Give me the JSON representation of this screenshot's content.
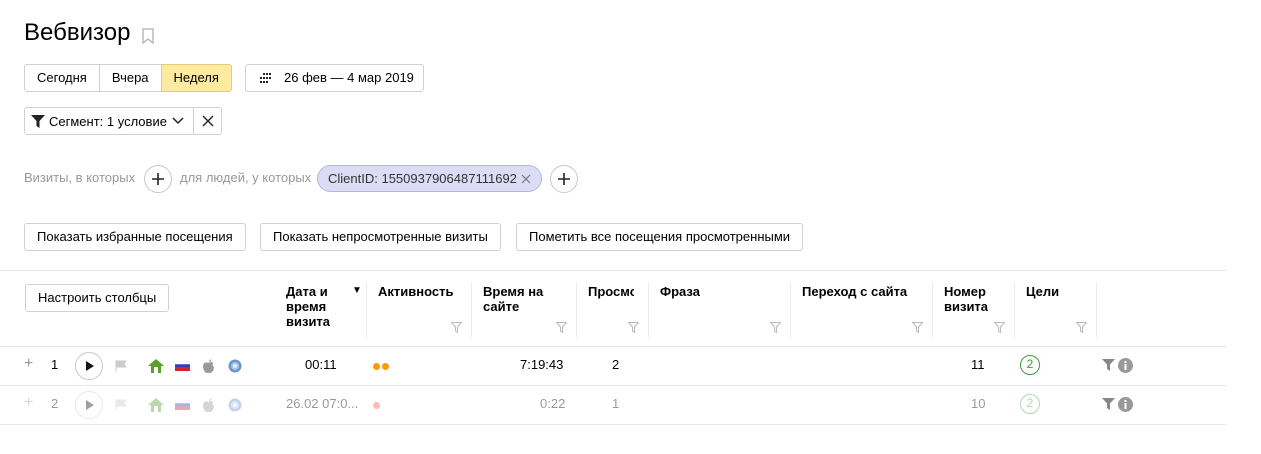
{
  "page": {
    "title": "Вебвизор"
  },
  "period": {
    "buttons": [
      "Сегодня",
      "Вчера",
      "Неделя"
    ],
    "active": "Неделя",
    "date_range": "26 фев — 4 мар 2019"
  },
  "segment": {
    "label": "Сегмент: 1 условие"
  },
  "conditions": {
    "visits_label": "Визиты, в которых",
    "people_label": "для людей, у которых",
    "chip": "ClientID: 1550937906487111692"
  },
  "actions": {
    "show_favorites": "Показать избранные посещения",
    "show_unviewed": "Показать непросмотренные визиты",
    "mark_all_viewed": "Пометить все посещения просмотренными"
  },
  "table": {
    "configure_columns": "Настроить столбцы",
    "headers": {
      "datetime": [
        "Дата и",
        "время",
        "визита"
      ],
      "sort_marker": "▼",
      "activity": "Активность",
      "time_on_site": [
        "Время на",
        "сайте"
      ],
      "views": "Просмо",
      "phrase": "Фраза",
      "referrer": "Переход с сайта",
      "visit_number": [
        "Номер",
        "визита"
      ],
      "goals": "Цели"
    },
    "rows": [
      {
        "expand": "+",
        "index": "1",
        "datetime": "00:11",
        "activity_dots": 2,
        "time_on_site": "7:19:43",
        "views": "2",
        "phrase": "",
        "referrer": "",
        "visit_number": "11",
        "goals": "2"
      },
      {
        "expand": "+",
        "index": "2",
        "datetime": "26.02 07:0...",
        "activity_dots": 1,
        "time_on_site": "0:22",
        "views": "1",
        "phrase": "",
        "referrer": "",
        "visit_number": "10",
        "goals": "2"
      }
    ]
  },
  "colors": {
    "active_period": "#ffeba0",
    "chip_bg": "#dcdcf5",
    "activity_high": "#ff9900",
    "activity_low": "#ff5544",
    "goal": "#3a9e3a",
    "os_home": "#5aa02c"
  },
  "icons": [
    "bookmark-icon",
    "calendar-grid-icon",
    "filter-icon",
    "chevron-down-icon",
    "close-icon",
    "plus-icon",
    "play-icon",
    "flag-icon",
    "home-icon",
    "russia-flag-icon",
    "apple-icon",
    "browser-icon",
    "info-icon"
  ]
}
